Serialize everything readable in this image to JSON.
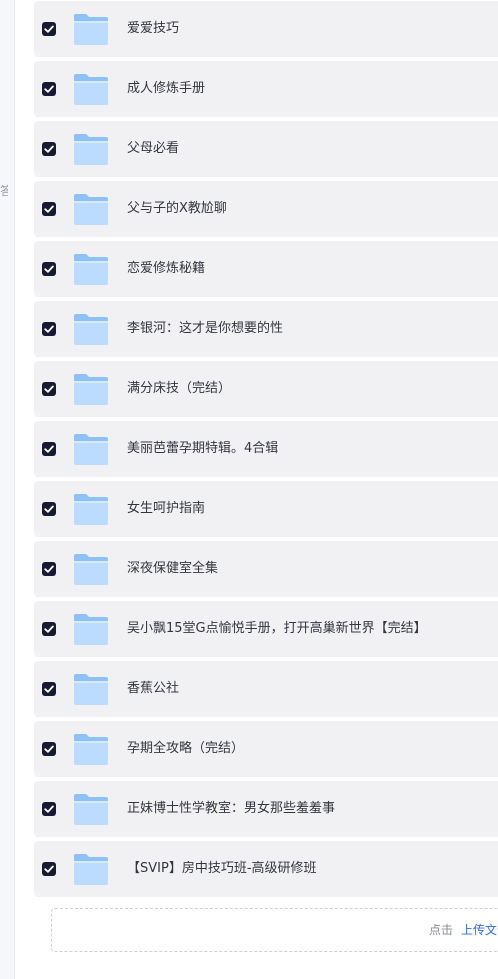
{
  "sidebar": {
    "edge_char": "答"
  },
  "folders": [
    {
      "name": "爱爱技巧",
      "checked": true
    },
    {
      "name": "成人修炼手册",
      "checked": true
    },
    {
      "name": "父母必看",
      "checked": true
    },
    {
      "name": "父与子的X教尬聊",
      "checked": true
    },
    {
      "name": "恋爱修炼秘籍",
      "checked": true
    },
    {
      "name": "李银河：这才是你想要的性",
      "checked": true
    },
    {
      "name": "满分床技（完结）",
      "checked": true
    },
    {
      "name": "美丽芭蕾孕期特辑。4合辑",
      "checked": true
    },
    {
      "name": "女生呵护指南",
      "checked": true
    },
    {
      "name": "深夜保健室全集",
      "checked": true
    },
    {
      "name": "吴小飘15堂G点愉悦手册，打开高巢新世界【完结】",
      "checked": true
    },
    {
      "name": "香蕉公社",
      "checked": true
    },
    {
      "name": "孕期全攻略（完结）",
      "checked": true
    },
    {
      "name": "正妹博士性学教室：男女那些羞羞事",
      "checked": true
    },
    {
      "name": "【SVIP】房中技巧班-高级研修班",
      "checked": true
    }
  ],
  "upload": {
    "prefix": "点击",
    "link": "上传文件"
  },
  "colors": {
    "row_bg": "#f1f1f4",
    "checkbox_bg": "#161a33",
    "folder_light": "#bcdcff",
    "folder_dark": "#8ec2f7",
    "link": "#2f6bd9"
  },
  "icons": {
    "checkbox": "checkbox-checked-icon",
    "folder": "folder-icon"
  }
}
